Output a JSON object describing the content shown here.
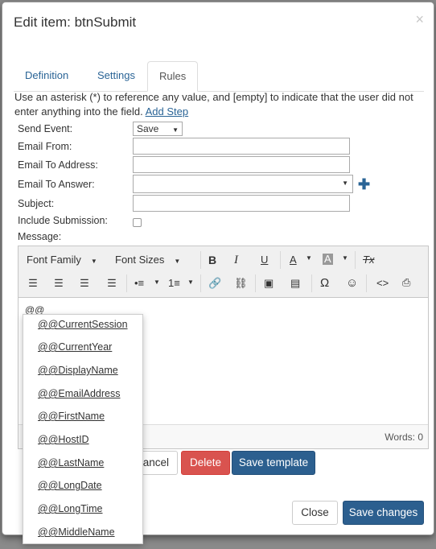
{
  "modal": {
    "title": "Edit item: btnSubmit",
    "close": "×"
  },
  "tabs": [
    {
      "label": "Definition"
    },
    {
      "label": "Settings"
    },
    {
      "label": "Rules"
    }
  ],
  "help": {
    "text": "Use an asterisk (*) to reference any value, and [empty] to indicate that the user did not enter anything into the field.",
    "link": "Add Step"
  },
  "form": {
    "send_event_label": "Send Event:",
    "send_event_value": "Save",
    "email_from_label": "Email From:",
    "email_to_address_label": "Email To Address:",
    "email_to_answer_label": "Email To Answer:",
    "subject_label": "Subject:",
    "include_submission_label": "Include Submission:",
    "message_label": "Message:"
  },
  "editor": {
    "font_family": "Font Family",
    "font_sizes": "Font Sizes",
    "bold": "B",
    "italic": "I",
    "underline": "U",
    "font_color": "A",
    "bg_color": "A",
    "clear_format": "Tx",
    "special_char": "Ω",
    "code": "<>",
    "content": "@@",
    "words": "Words: 0"
  },
  "buttons": {
    "cancel": "ancel",
    "delete": "Delete",
    "save_template": "Save template",
    "close": "Close",
    "save_changes": "Save changes"
  },
  "autocomplete": [
    "@@CurrentSession",
    "@@CurrentYear",
    "@@DisplayName",
    "@@EmailAddress",
    "@@FirstName",
    "@@HostID",
    "@@LastName",
    "@@LongDate",
    "@@LongTime",
    "@@MiddleName"
  ],
  "colors": {
    "primary": "#2c5f8f",
    "danger": "#d9534f",
    "link": "#2a6496"
  }
}
